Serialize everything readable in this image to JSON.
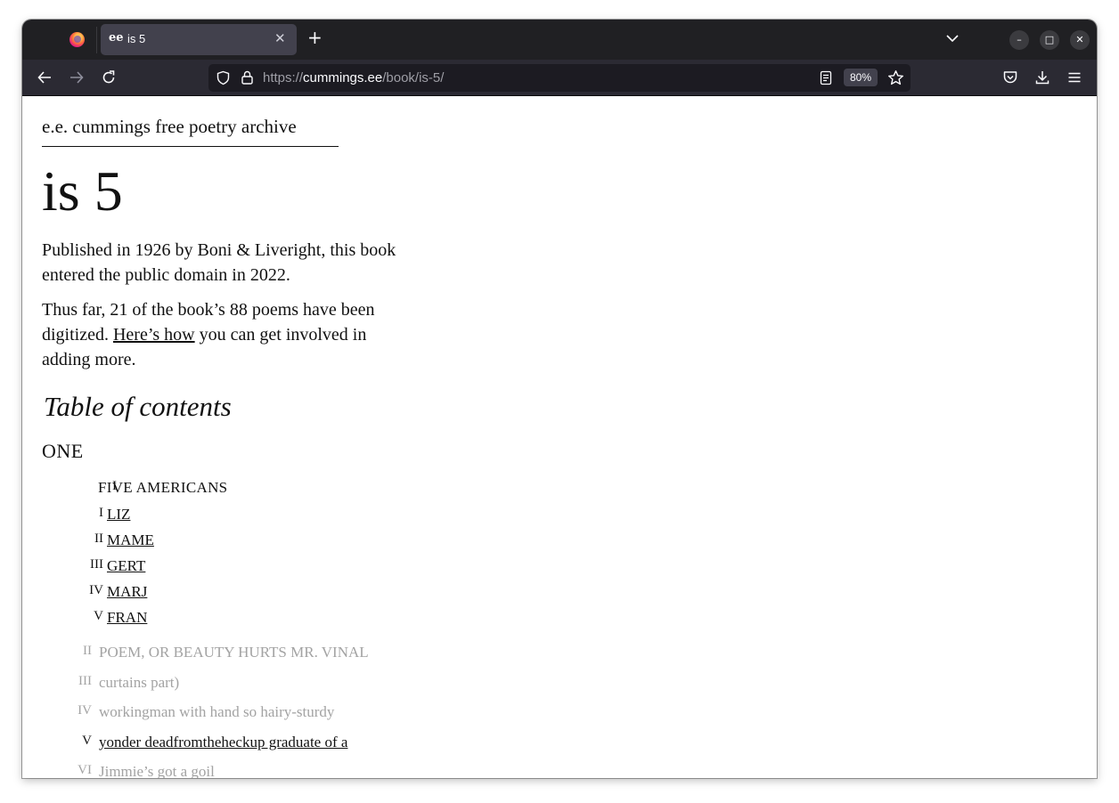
{
  "browser": {
    "tab_title": "is 5",
    "tab_favicon": "ee",
    "url_prefix": "https://",
    "url_host": "cummings.ee",
    "url_path": "/book/is-5/",
    "zoom": "80%"
  },
  "page": {
    "site_title": "e.e. cummings free poetry archive",
    "book_title": "is 5",
    "intro": "Published in 1926 by Boni & Liveright, this book entered the public domain in 2022.",
    "status_before": "Thus far, 21 of the book’s 88 poems have been digitized. ",
    "status_link": "Here’s how",
    "status_after": " you can get involved in adding more.",
    "toc_heading": "Table of contents",
    "part": "ONE",
    "section1_num": "I",
    "section1_title": "FIVE AMERICANS",
    "sub_nums": [
      "I",
      "II",
      "III",
      "IV",
      "V"
    ],
    "sub_titles": [
      "LIZ",
      "MAME",
      "GERT",
      "MARJ",
      "FRAN"
    ],
    "poem_nums": [
      "II",
      "III",
      "IV",
      "V",
      "VI"
    ],
    "poem_titles": [
      "POEM, OR BEAUTY HURTS MR. VINAL",
      "curtains part)",
      "workingman with hand so hairy-sturdy",
      "yonder deadfromtheheckup graduate of a",
      "Jimmie’s got a goil"
    ]
  }
}
